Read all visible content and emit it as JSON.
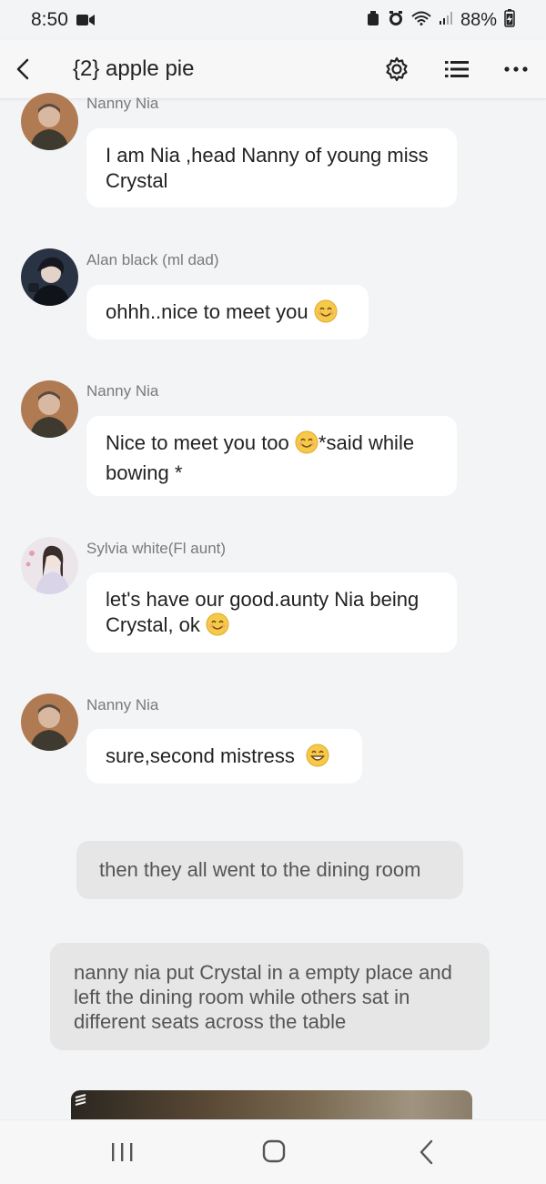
{
  "status_bar": {
    "time": "8:50",
    "battery": "88%"
  },
  "header": {
    "title": "{2} apple pie",
    "icons": [
      "back-icon",
      "settings-gear-icon",
      "list-menu-icon",
      "more-options-icon"
    ]
  },
  "messages": [
    {
      "sender": "Nanny Nia",
      "text": "I am Nia ,head Nanny of young miss Crystal",
      "avatar": "nanny-nia"
    },
    {
      "sender": "Alan black (ml dad)",
      "text": "ohhh..nice to meet you",
      "emoji": "smiling-face-emoji",
      "avatar": "alan-black"
    },
    {
      "sender": "Nanny Nia",
      "text_before": "Nice to meet you too",
      "text_after": "*said while bowing *",
      "emoji": "smiling-face-emoji",
      "avatar": "nanny-nia"
    },
    {
      "sender": "Sylvia white(Fl aunt)",
      "text": "let's have our good.aunty Nia being Crystal, ok",
      "emoji": "smiling-face-emoji",
      "avatar": "sylvia-white"
    },
    {
      "sender": "Nanny Nia",
      "text": "sure,second mistress",
      "emoji": "grinning-face-emoji",
      "avatar": "nanny-nia"
    }
  ],
  "narrations": [
    "then they all went to the dining room",
    "nanny nia put Crystal in a empty place and left the dining room while others sat in different seats across the table"
  ],
  "colors": {
    "background": "#f3f4f6",
    "bubble": "#ffffff",
    "narration_bubble": "#e6e6e7",
    "sender_text": "#7a7a7a"
  },
  "navbar": {
    "icons": [
      "recent-apps-icon",
      "home-icon",
      "back-nav-icon"
    ]
  }
}
